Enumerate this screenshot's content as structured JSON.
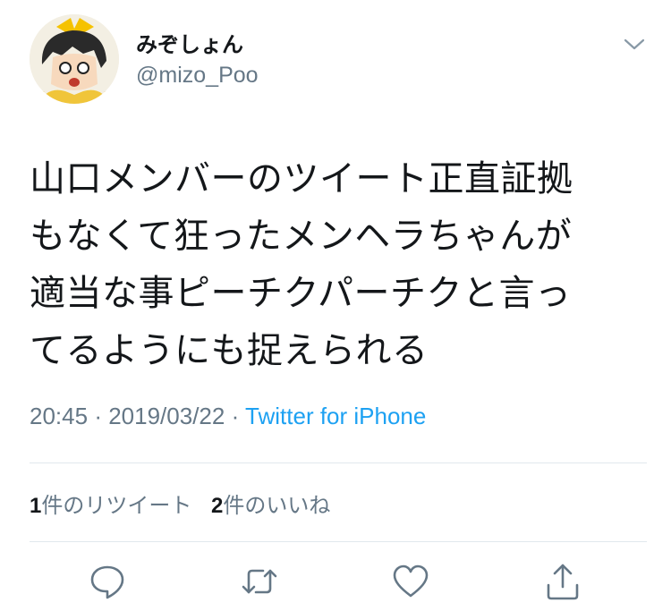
{
  "tweet": {
    "author": {
      "display_name": "みぞしょん",
      "handle": "@mizo_Poo"
    },
    "text_lines": [
      "山口メンバーのツイート正直証拠",
      "もなくて狂ったメンヘラちゃんが",
      "適当な事ピーチクパーチクと言っ",
      "てるようにも捉えられる"
    ],
    "time": "20:45",
    "separator": "·",
    "date": "2019/03/22",
    "source": "Twitter for iPhone"
  },
  "stats": {
    "retweets": {
      "count": "1",
      "label": "件のリツイート"
    },
    "likes": {
      "count": "2",
      "label": "件のいいね"
    }
  },
  "icons": {
    "more": "chevron-down-icon",
    "reply": "reply-icon",
    "retweet": "retweet-icon",
    "like": "heart-icon",
    "share": "share-icon"
  },
  "colors": {
    "text": "#14171a",
    "secondary": "#657786",
    "link": "#1da1f2",
    "divider": "#e1e8ed"
  }
}
